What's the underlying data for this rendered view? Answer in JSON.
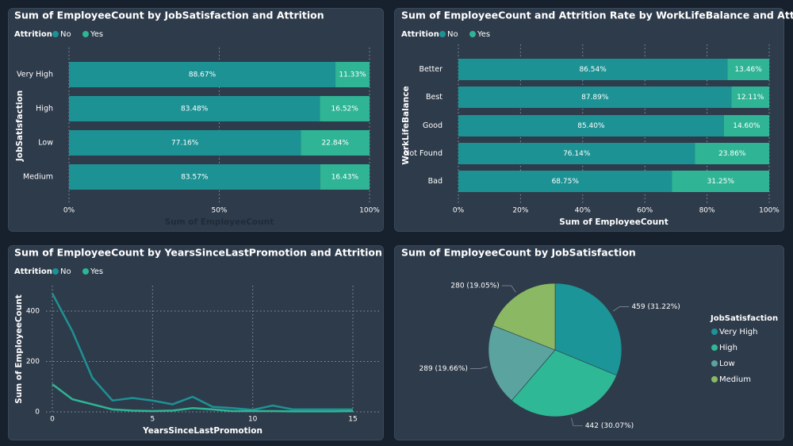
{
  "colors": {
    "no": "#1d9294",
    "yes": "#2fb595",
    "panel": "#2e3b4b",
    "background": "#17212e",
    "text": "#ffffff",
    "grid": "#8a95a3"
  },
  "chart_data": [
    {
      "type": "bar",
      "orientation": "horizontal",
      "stacked": "100%",
      "title": "Sum of EmployeeCount by JobSatisfaction and Attrition",
      "legend_title": "Attrition",
      "legend_placement": "top-left",
      "ylabel": "JobSatisfaction",
      "xlabel": "Sum of EmployeeCount",
      "categories": [
        "Very High",
        "High",
        "Low",
        "Medium"
      ],
      "xticks": [
        "0%",
        "50%",
        "100%"
      ],
      "xlim": [
        0,
        100
      ],
      "series": [
        {
          "name": "No",
          "values": [
            88.67,
            83.48,
            77.16,
            83.57
          ],
          "labels": [
            "88.67%",
            "83.48%",
            "77.16%",
            "83.57%"
          ]
        },
        {
          "name": "Yes",
          "values": [
            11.33,
            16.52,
            22.84,
            16.43
          ],
          "labels": [
            "11.33%",
            "16.52%",
            "22.84%",
            "16.43%"
          ]
        }
      ],
      "grid": true
    },
    {
      "type": "bar",
      "orientation": "horizontal",
      "stacked": "100%",
      "title": "Sum of EmployeeCount and Attrition Rate by WorkLifeBalance and Attrition",
      "legend_title": "Attrition",
      "legend_placement": "top-left",
      "ylabel": "WorkLifeBalance",
      "xlabel": "Sum of EmployeeCount",
      "categories": [
        "Better",
        "Best",
        "Good",
        "Not Found",
        "Bad"
      ],
      "xticks": [
        "0%",
        "20%",
        "40%",
        "60%",
        "80%",
        "100%"
      ],
      "xlim": [
        0,
        100
      ],
      "series": [
        {
          "name": "No",
          "values": [
            86.54,
            87.89,
            85.4,
            76.14,
            68.75
          ],
          "labels": [
            "86.54%",
            "87.89%",
            "85.40%",
            "76.14%",
            "68.75%"
          ]
        },
        {
          "name": "Yes",
          "values": [
            13.46,
            12.11,
            14.6,
            23.86,
            31.25
          ],
          "labels": [
            "13.46%",
            "12.11%",
            "14.60%",
            "23.86%",
            "31.25%"
          ]
        }
      ],
      "grid": true
    },
    {
      "type": "line",
      "title": "Sum of EmployeeCount by YearsSinceLastPromotion and Attrition",
      "legend_title": "Attrition",
      "legend_placement": "top-left",
      "xlabel": "YearsSinceLastPromotion",
      "ylabel": "Sum of EmployeeCount",
      "xlim": [
        0,
        15
      ],
      "ylim": [
        0,
        480
      ],
      "xticks": [
        "0",
        "5",
        "10",
        "15"
      ],
      "yticks": [
        "0",
        "200",
        "400"
      ],
      "x": [
        0,
        1,
        2,
        3,
        4,
        5,
        6,
        7,
        8,
        9,
        10,
        11,
        12,
        13,
        14,
        15
      ],
      "series": [
        {
          "name": "No",
          "values": [
            470,
            320,
            135,
            45,
            55,
            45,
            30,
            60,
            20,
            15,
            8,
            25,
            10,
            10,
            10,
            10
          ]
        },
        {
          "name": "Yes",
          "values": [
            110,
            50,
            30,
            10,
            5,
            3,
            5,
            15,
            10,
            3,
            3,
            3,
            2,
            2,
            2,
            3
          ]
        }
      ],
      "grid": true
    },
    {
      "type": "pie",
      "title": "Sum of EmployeeCount by JobSatisfaction",
      "legend_title": "JobSatisfaction",
      "legend_placement": "right",
      "categories": [
        "Very High",
        "High",
        "Low",
        "Medium"
      ],
      "values": [
        459,
        442,
        289,
        280
      ],
      "labels": [
        "459 (31.22%)",
        "442 (30.07%)",
        "289 (19.66%)",
        "280 (19.05%)"
      ],
      "colors": [
        "#1b9597",
        "#2fb895",
        "#5ba39e",
        "#8ab863"
      ]
    }
  ]
}
